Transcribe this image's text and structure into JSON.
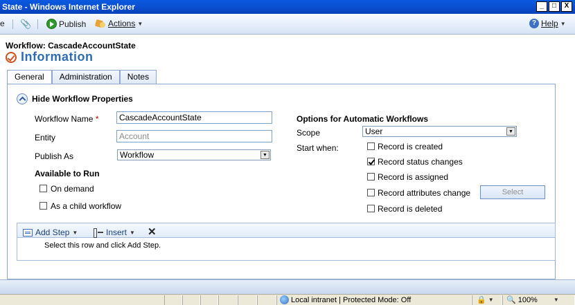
{
  "window": {
    "title": "State - Windows Internet Explorer",
    "minimize": "_",
    "maximize": "□",
    "close": "X"
  },
  "toolbar": {
    "left_fragment": "e",
    "publish_label": "Publish",
    "actions_label": "Actions",
    "help_label": "Help"
  },
  "header": {
    "record_title": "Workflow: CascadeAccountState",
    "section_title": "Information"
  },
  "tabs": [
    {
      "label": "General",
      "active": true
    },
    {
      "label": "Administration",
      "active": false
    },
    {
      "label": "Notes",
      "active": false
    }
  ],
  "properties": {
    "toggle_label": "Hide Workflow Properties",
    "workflow_name_label": "Workflow Name",
    "required_mark": "*",
    "workflow_name_value": "CascadeAccountState",
    "entity_label": "Entity",
    "entity_value": "Account",
    "publish_as_label": "Publish As",
    "publish_as_value": "Workflow",
    "available_heading": "Available to Run",
    "on_demand_label": "On demand",
    "on_demand_checked": false,
    "child_label": "As a child workflow",
    "child_checked": false
  },
  "options": {
    "heading": "Options for Automatic Workflows",
    "scope_label": "Scope",
    "scope_value": "User",
    "start_when_label": "Start when:",
    "triggers": [
      {
        "label": "Record is created",
        "checked": false
      },
      {
        "label": "Record status changes",
        "checked": true
      },
      {
        "label": "Record is assigned",
        "checked": false
      },
      {
        "label": "Record attributes change",
        "checked": false
      },
      {
        "label": "Record is deleted",
        "checked": false
      }
    ],
    "select_button": "Select"
  },
  "steps": {
    "add_step_label": "Add Step",
    "insert_label": "Insert",
    "delete_glyph": "✕",
    "hint": "Select this row and click Add Step."
  },
  "status": {
    "zone": "Local intranet | Protected Mode: Off",
    "zoom": "100%"
  }
}
